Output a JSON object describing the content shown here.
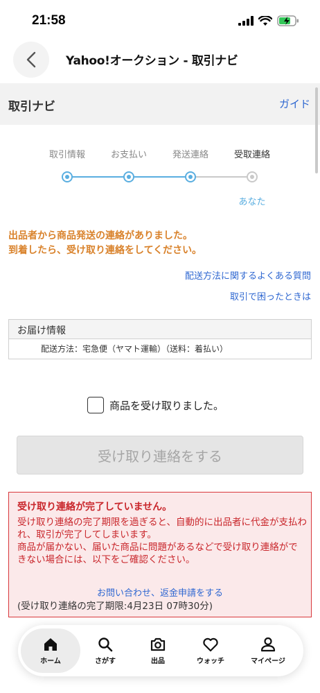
{
  "status": {
    "time": "21:58"
  },
  "header": {
    "title": "Yahoo!オークション - 取引ナビ"
  },
  "section": {
    "title": "取引ナビ",
    "guide": "ガイド"
  },
  "steps": {
    "items": [
      {
        "label": "取引情報",
        "done": true
      },
      {
        "label": "お支払い",
        "done": true
      },
      {
        "label": "発送連絡",
        "done": true
      },
      {
        "label": "受取連絡",
        "done": false,
        "current": true
      }
    ],
    "you_label": "あなた"
  },
  "message": {
    "line1": "出品者から商品発送の連絡がありました。",
    "line2": "到着したら、受け取り連絡をしてください。"
  },
  "links": {
    "shipping_faq": "配送方法に関するよくある質問",
    "trouble": "取引で困ったときは"
  },
  "delivery": {
    "title": "お届け情報",
    "method": "配送方法：宅急便（ヤマト運輸）（送料：着払い）"
  },
  "confirm": {
    "checkbox_label": "商品を受け取りました。",
    "button_label": "受け取り連絡をする"
  },
  "warning": {
    "title": "受け取り連絡が完了していません。",
    "text1": "受け取り連絡の完了期限を過ぎると、自動的に出品者に代金が支払われ、取引が完了してしまいます。",
    "text2": "商品が届かない、届いた商品に問題があるなどで受け取り連絡ができない場合には、以下をご確認ください。",
    "link": "お問い合わせ、返金申請をする",
    "deadline": "(受け取り連絡の完了期限:4月23日 07時30分)"
  },
  "tabbar": {
    "items": [
      {
        "label": "ホーム",
        "icon": "home-icon",
        "active": true
      },
      {
        "label": "さがす",
        "icon": "search-icon"
      },
      {
        "label": "出品",
        "icon": "camera-icon"
      },
      {
        "label": "ウォッチ",
        "icon": "heart-icon"
      },
      {
        "label": "マイページ",
        "icon": "person-icon"
      }
    ]
  },
  "colors": {
    "accent": "#2e67d1",
    "step": "#5aaee0",
    "notice": "#d9822b",
    "warning": "#c9262b"
  }
}
